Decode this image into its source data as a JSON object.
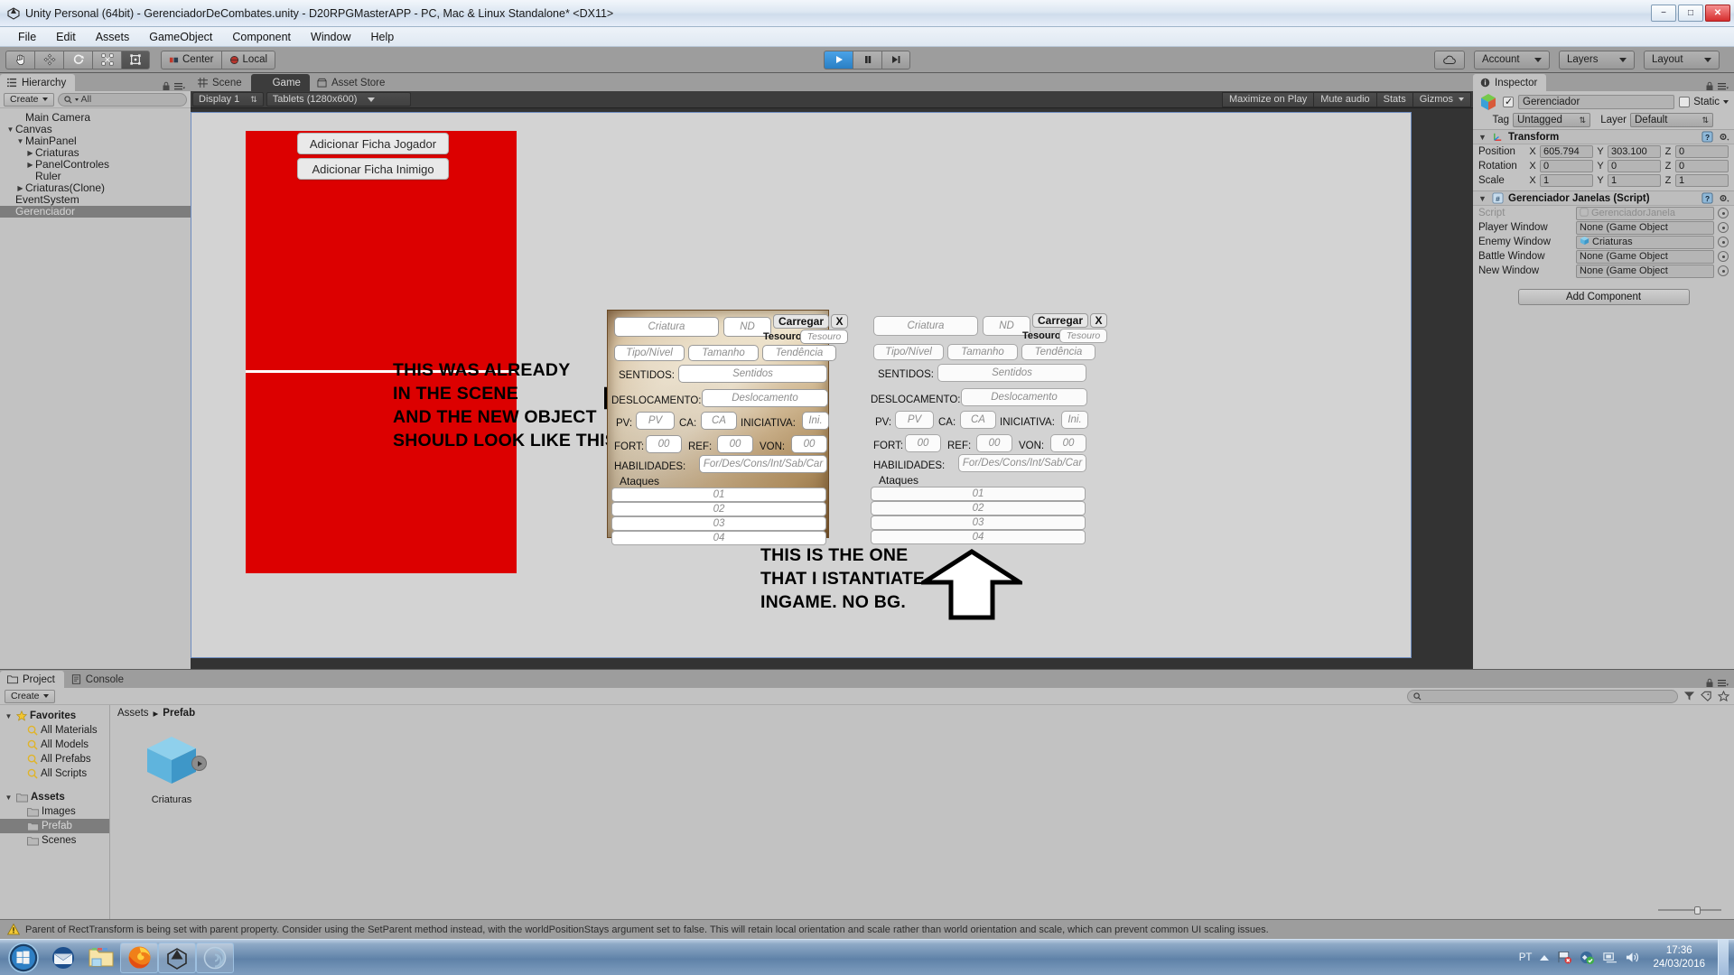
{
  "window": {
    "title": "Unity Personal (64bit) - GerenciadorDeCombates.unity - D20RPGMasterAPP - PC, Mac & Linux Standalone* <DX11>",
    "minimize": "−",
    "maximize": "□",
    "close": "✕"
  },
  "menubar": {
    "items": [
      "File",
      "Edit",
      "Assets",
      "GameObject",
      "Component",
      "Window",
      "Help"
    ]
  },
  "toolbar": {
    "pivot_mode": "Center",
    "pivot_rotation": "Local",
    "account": "Account",
    "layers": "Layers",
    "layout": "Layout"
  },
  "hierarchy": {
    "tab": "Hierarchy",
    "create": "Create",
    "search_placeholder": "All",
    "items": [
      {
        "label": "Main Camera",
        "depth": 1,
        "arrow": "none",
        "selected": false
      },
      {
        "label": "Canvas",
        "depth": 0,
        "arrow": "open",
        "selected": false
      },
      {
        "label": "MainPanel",
        "depth": 1,
        "arrow": "open",
        "selected": false
      },
      {
        "label": "Criaturas",
        "depth": 2,
        "arrow": "closed",
        "selected": false
      },
      {
        "label": "PanelControles",
        "depth": 2,
        "arrow": "closed",
        "selected": false
      },
      {
        "label": "Ruler",
        "depth": 2,
        "arrow": "none",
        "selected": false
      },
      {
        "label": "Criaturas(Clone)",
        "depth": 1,
        "arrow": "closed",
        "selected": false
      },
      {
        "label": "EventSystem",
        "depth": 0,
        "arrow": "none",
        "selected": false
      },
      {
        "label": "Gerenciador",
        "depth": 0,
        "arrow": "none",
        "selected": true
      }
    ]
  },
  "view": {
    "tabs": [
      {
        "label": "Scene",
        "active": false
      },
      {
        "label": "Game",
        "active": true
      },
      {
        "label": "Asset Store",
        "active": false
      }
    ],
    "display": "Display 1",
    "aspect": "Tablets (1280x600)",
    "toggles": [
      "Maximize on Play",
      "Mute audio",
      "Stats",
      "Gizmos"
    ]
  },
  "game": {
    "buttons": [
      {
        "label": "Adicionar Ficha Jogador"
      },
      {
        "label": "Adicionar Ficha Inimigo"
      }
    ],
    "annotations": [
      {
        "lines": [
          "THIS WAS ALREADY",
          "IN THE SCENE",
          "AND THE NEW OBJECT",
          "SHOULD LOOK LIKE THIS"
        ],
        "arrow": "right"
      },
      {
        "lines": [
          "THIS IS THE ONE",
          "THAT I ISTANTIATE",
          "INGAME. NO BG."
        ],
        "arrow": "up"
      }
    ]
  },
  "sheet": {
    "name_placeholder": "Criatura",
    "nd_placeholder": "ND",
    "carregar": "Carregar",
    "close": "X",
    "tesouro_label": "Tesouro:",
    "tesouro_placeholder": "Tesouro",
    "tipo_placeholder": "Tipo/Nível",
    "tamanho_placeholder": "Tamanho",
    "tendencia_placeholder": "Tendência",
    "sentidos_label": "SENTIDOS:",
    "sentidos_placeholder": "Sentidos",
    "deslocamento_label": "DESLOCAMENTO:",
    "deslocamento_placeholder": "Deslocamento",
    "pv_label": "PV:",
    "pv_placeholder": "PV",
    "ca_label": "CA:",
    "ca_placeholder": "CA",
    "iniciativa_label": "INICIATIVA:",
    "iniciativa_placeholder": "Ini.",
    "fort_label": "FORT:",
    "fort_placeholder": "00",
    "ref_label": "REF:",
    "ref_placeholder": "00",
    "von_label": "VON:",
    "von_placeholder": "00",
    "habilidades_label": "HABILIDADES:",
    "habilidades_placeholder": "For/Des/Cons/Int/Sab/Car",
    "ataques_label": "Ataques",
    "attacks": [
      "01",
      "02",
      "03",
      "04"
    ]
  },
  "inspector": {
    "tab": "Inspector",
    "object_name": "Gerenciador",
    "enabled": true,
    "static_label": "Static",
    "tag_label": "Tag",
    "tag_value": "Untagged",
    "layer_label": "Layer",
    "layer_value": "Default",
    "transform": {
      "title": "Transform",
      "rows": [
        {
          "label": "Position",
          "x": "605.794",
          "y": "303.100",
          "z": "0"
        },
        {
          "label": "Rotation",
          "x": "0",
          "y": "0",
          "z": "0"
        },
        {
          "label": "Scale",
          "x": "1",
          "y": "1",
          "z": "1"
        }
      ],
      "axes": [
        "X",
        "Y",
        "Z"
      ]
    },
    "script_component": {
      "title": "Gerenciador Janelas (Script)",
      "fields": [
        {
          "label": "Script",
          "value": "GerenciadorJanela",
          "dim": true,
          "has_cube": false
        },
        {
          "label": "Player Window",
          "value": "None (Game Object",
          "dim": false,
          "has_cube": false
        },
        {
          "label": "Enemy Window",
          "value": "Criaturas",
          "dim": false,
          "has_cube": true
        },
        {
          "label": "Battle Window",
          "value": "None (Game Object",
          "dim": false,
          "has_cube": false
        },
        {
          "label": "New Window",
          "value": "None (Game Object",
          "dim": false,
          "has_cube": false
        }
      ]
    },
    "add_component": "Add Component"
  },
  "project": {
    "tabs": [
      {
        "label": "Project",
        "active": true
      },
      {
        "label": "Console",
        "active": false
      }
    ],
    "create": "Create",
    "search_placeholder": "",
    "tree": [
      {
        "label": "Favorites",
        "type": "star",
        "depth": 0,
        "sel": false,
        "arrow": "open"
      },
      {
        "label": "All Materials",
        "type": "search",
        "depth": 1,
        "sel": false,
        "arrow": "none"
      },
      {
        "label": "All Models",
        "type": "search",
        "depth": 1,
        "sel": false,
        "arrow": "none"
      },
      {
        "label": "All Prefabs",
        "type": "search",
        "depth": 1,
        "sel": false,
        "arrow": "none"
      },
      {
        "label": "All Scripts",
        "type": "search",
        "depth": 1,
        "sel": false,
        "arrow": "none"
      },
      {
        "label": "",
        "type": "gap",
        "depth": 0,
        "sel": false,
        "arrow": "none"
      },
      {
        "label": "Assets",
        "type": "folder",
        "depth": 0,
        "sel": false,
        "arrow": "open"
      },
      {
        "label": "Images",
        "type": "folder",
        "depth": 1,
        "sel": false,
        "arrow": "none"
      },
      {
        "label": "Prefab",
        "type": "folder",
        "depth": 1,
        "sel": true,
        "arrow": "none"
      },
      {
        "label": "Scenes",
        "type": "folder",
        "depth": 1,
        "sel": false,
        "arrow": "none"
      }
    ],
    "breadcrumb": {
      "root": "Assets",
      "sep": "▸",
      "current": "Prefab"
    },
    "assets": [
      {
        "label": "Criaturas"
      }
    ]
  },
  "status": {
    "message": "Parent of RectTransform is being set with parent property. Consider using the SetParent method instead, with the worldPositionStays argument set to false. This will retain local orientation and scale rather than world orientation and scale, which can prevent common UI scaling issues."
  },
  "taskbar": {
    "language": "PT",
    "time": "17:36",
    "date": "24/03/2016",
    "items": [
      "thunderbird-icon",
      "explorer-icon",
      "firefox-icon",
      "unity-icon",
      "photoshop-icon"
    ]
  }
}
